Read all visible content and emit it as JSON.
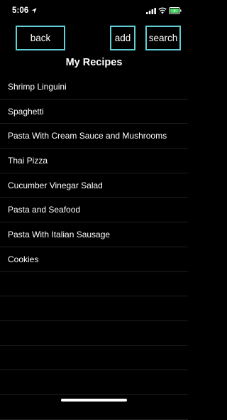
{
  "status_bar": {
    "time": "5:06",
    "icons": [
      "location-arrow-icon",
      "cellular-signal-icon",
      "wifi-icon",
      "battery-charging-icon"
    ]
  },
  "header": {
    "back_label": "back",
    "add_label": "add",
    "search_label": "search",
    "title": "My Recipes",
    "button_border_color": "#62d0d2"
  },
  "recipes": [
    "Shrimp Linguini",
    "Spaghetti",
    "Pasta With Cream Sauce and Mushrooms",
    "Thai Pizza",
    "Cucumber Vinegar Salad",
    "Pasta and Seafood",
    "Pasta With Italian Sausage",
    "Cookies"
  ],
  "colors": {
    "background": "#000000",
    "text": "#ffffff",
    "separator": "#1f1f1f",
    "battery_charge": "#4cd964"
  }
}
